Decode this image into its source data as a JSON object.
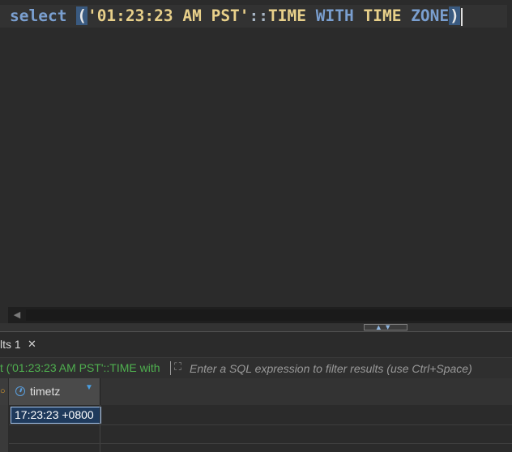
{
  "editor": {
    "sql": {
      "keyword_select": "select",
      "open_paren": "(",
      "string_literal": "'01:23:23 AM PST'",
      "cast_op": "::",
      "type_time": "TIME",
      "kw_with": "WITH",
      "kw_time": "TIME",
      "kw_zone": "ZONE",
      "close_paren": ")"
    }
  },
  "results": {
    "tab_label": "lts 1",
    "tab_close_icon": "close-icon",
    "filter": {
      "query_text": "t ('01:23:23 AM PST'::TIME with",
      "placeholder": "Enter a SQL expression to filter results (use Ctrl+Space)"
    },
    "grid": {
      "columns": [
        {
          "name": "timetz",
          "icon": "clock-icon"
        }
      ],
      "rows": [
        [
          "17:23:23 +0800"
        ]
      ]
    }
  },
  "colors": {
    "editor_bg": "#2b2b2b",
    "keyword": "#7a9fd0",
    "string": "#e8d08a",
    "filter_query": "#4fb04f",
    "selected_cell": "#1f3a5c"
  }
}
